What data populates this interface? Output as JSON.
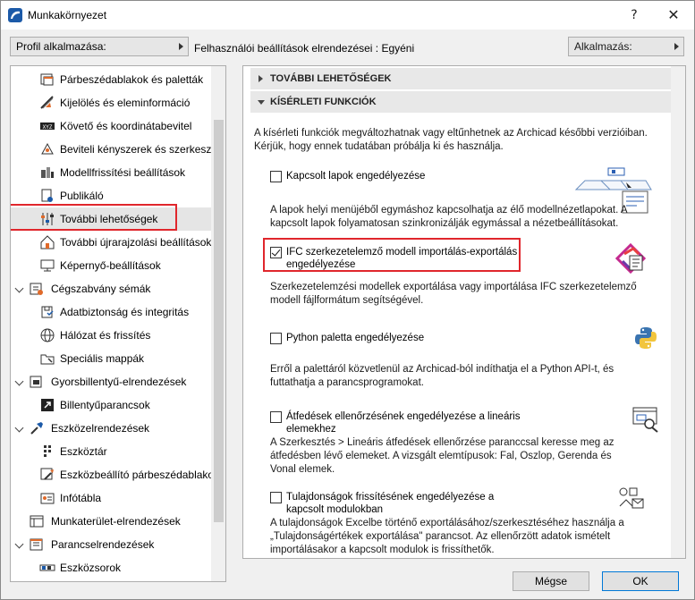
{
  "window": {
    "title": "Munkakörnyezet",
    "help_label": "?",
    "close_label": "✕"
  },
  "toolbar": {
    "profile_label": "Profil alkalmazása:",
    "scheme_text": "Felhasználói beállítások elrendezései : Egyéni",
    "apply_label": "Alkalmazás:"
  },
  "tree": {
    "items": [
      {
        "label": "Párbeszédablakok és paletták",
        "icon": "dialogs-icon"
      },
      {
        "label": "Kijelölés és eleminformáció",
        "icon": "selection-icon"
      },
      {
        "label": "Követő és koordinátabevitel",
        "icon": "tracker-icon"
      },
      {
        "label": "Beviteli kényszerek és szerkesztővonalak",
        "icon": "constraints-icon"
      },
      {
        "label": "Modellfrissítési beállítások",
        "icon": "model-update-icon"
      },
      {
        "label": "Publikáló",
        "icon": "publisher-icon"
      },
      {
        "label": "További lehetőségek",
        "icon": "more-options-icon"
      },
      {
        "label": "További újrarajzolási beállítások",
        "icon": "redraw-icon"
      },
      {
        "label": "Képernyő-beállítások",
        "icon": "screen-icon"
      },
      {
        "label": "Cégszabvány sémák",
        "icon": "company-standards-icon"
      },
      {
        "label": "Adatbiztonság és integritás",
        "icon": "data-safety-icon"
      },
      {
        "label": "Hálózat és frissítés",
        "icon": "network-icon"
      },
      {
        "label": "Speciális mappák",
        "icon": "special-folders-icon"
      },
      {
        "label": "Gyorsbillentyű-elrendezések",
        "icon": "shortcut-schemes-icon"
      },
      {
        "label": "Billentyűparancsok",
        "icon": "keyboard-shortcuts-icon"
      },
      {
        "label": "Eszközelrendezések",
        "icon": "tool-schemes-icon"
      },
      {
        "label": "Eszköztár",
        "icon": "toolbox-icon"
      },
      {
        "label": "Eszközbeállító párbeszédablakok",
        "icon": "tool-settings-icon"
      },
      {
        "label": "Infótábla",
        "icon": "info-box-icon"
      },
      {
        "label": "Munkaterület-elrendezések",
        "icon": "workspace-schemes-icon"
      },
      {
        "label": "Parancselrendezések",
        "icon": "command-schemes-icon"
      },
      {
        "label": "Eszközsorok",
        "icon": "toolbars-icon"
      }
    ]
  },
  "content": {
    "section_more": "TOVÁBBI LEHETŐSÉGEK",
    "section_experimental": "KÍSÉRLETI FUNKCIÓK",
    "intro": "A kísérleti funkciók megváltozhatnak vagy eltűnhetnek az Archicad későbbi verzióiban. Kérjük, hogy ennek tudatában próbálja ki és használja.",
    "features": [
      {
        "label": "Kapcsolt lapok engedélyezése",
        "checked": false,
        "desc": "A lapok helyi menüjéből egymáshoz kapcsolhatja az élő modellnézetlapokat. A kapcsolt lapok folyamatosan szinkronizálják egymással a nézetbeállításokat.",
        "icon": "linked-tabs-icon"
      },
      {
        "label": "IFC szerkezetelemző modell importálás-exportálás engedélyezése",
        "checked": true,
        "desc": "Szerkezetelemzési modellek exportálása vagy importálása IFC szerkezetelemző modell fájlformátum segítségével.",
        "icon": "ifc-icon"
      },
      {
        "label": "Python paletta engedélyezése",
        "checked": false,
        "desc": "Erről a palettáról közvetlenül az Archicad-ból indíthatja el a Python API-t, és futtathatja a parancsprogramokat.",
        "icon": "python-icon"
      },
      {
        "label": "Átfedések ellenőrzésének engedélyezése a lineáris elemekhez",
        "checked": false,
        "desc": "A Szerkesztés > Lineáris átfedések ellenőrzése paranccsal keresse meg az átfedésben lévő elemeket. A vizsgált elemtípusok: Fal, Oszlop, Gerenda és Vonal elemek.",
        "icon": "overlap-check-icon"
      },
      {
        "label": "Tulajdonságok frissítésének engedélyezése a kapcsolt modulokban",
        "checked": false,
        "desc": "A tulajdonságok Excelbe történő exportálásához/szerkesztéséhez használja a „Tulajdonságértékek exportálása\" parancsot. Az ellenőrzött adatok ismételt importálásakor a kapcsolt modulok is frissíthetők.",
        "icon": "property-update-icon"
      }
    ]
  },
  "buttons": {
    "cancel": "Mégse",
    "ok": "OK"
  },
  "colors": {
    "highlight_frame": "#e0262c",
    "ok_border": "#0078d7"
  }
}
